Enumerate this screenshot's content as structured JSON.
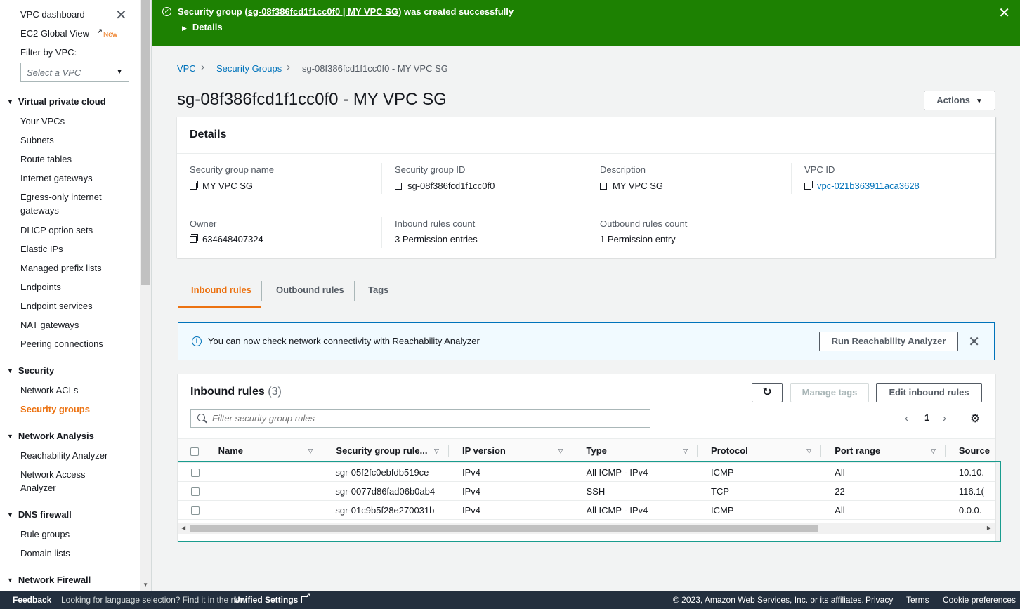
{
  "sidebar": {
    "vpc_dashboard": "VPC dashboard",
    "ec2_global_view": "EC2 Global View",
    "new_badge": "New",
    "filter_label": "Filter by VPC:",
    "vpc_select_placeholder": "Select a VPC",
    "sections": [
      {
        "title": "Virtual private cloud",
        "items": [
          "Your VPCs",
          "Subnets",
          "Route tables",
          "Internet gateways",
          "Egress-only internet gateways",
          "DHCP option sets",
          "Elastic IPs",
          "Managed prefix lists",
          "Endpoints",
          "Endpoint services",
          "NAT gateways",
          "Peering connections"
        ]
      },
      {
        "title": "Security",
        "items": [
          "Network ACLs",
          "Security groups"
        ]
      },
      {
        "title": "Network Analysis",
        "items": [
          "Reachability Analyzer",
          "Network Access Analyzer"
        ]
      },
      {
        "title": "DNS firewall",
        "items": [
          "Rule groups",
          "Domain lists"
        ]
      },
      {
        "title": "Network Firewall",
        "items": []
      }
    ]
  },
  "flash": {
    "prefix": "Security group (",
    "link": "sg-08f386fcd1f1cc0f0 | MY VPC SG",
    "suffix": ") was created successfully",
    "details": "Details",
    "color": "#1d8102"
  },
  "breadcrumb": [
    "VPC",
    "Security Groups",
    "sg-08f386fcd1f1cc0f0 - MY VPC SG"
  ],
  "page_title": "sg-08f386fcd1f1cc0f0 - MY VPC SG",
  "actions_label": "Actions",
  "details": {
    "header": "Details",
    "sg_name_label": "Security group name",
    "sg_name": "MY VPC SG",
    "sg_id_label": "Security group ID",
    "sg_id": "sg-08f386fcd1f1cc0f0",
    "description_label": "Description",
    "description": "MY VPC SG",
    "vpc_id_label": "VPC ID",
    "vpc_id": "vpc-021b363911aca3628",
    "owner_label": "Owner",
    "owner": "634648407324",
    "inbound_count_label": "Inbound rules count",
    "inbound_count": "3 Permission entries",
    "outbound_count_label": "Outbound rules count",
    "outbound_count": "1 Permission entry"
  },
  "tabs": [
    "Inbound rules",
    "Outbound rules",
    "Tags"
  ],
  "info_banner": {
    "message": "You can now check network connectivity with Reachability Analyzer",
    "button": "Run Reachability Analyzer"
  },
  "rules_panel": {
    "title": "Inbound rules",
    "count": "(3)",
    "manage_tags": "Manage tags",
    "edit_rules": "Edit inbound rules",
    "filter_placeholder": "Filter security group rules",
    "page": "1",
    "columns": [
      "Name",
      "Security group rule...",
      "IP version",
      "Type",
      "Protocol",
      "Port range",
      "Source"
    ],
    "rows": [
      [
        "–",
        "sgr-05f2fc0ebfdb519ce",
        "IPv4",
        "All ICMP - IPv4",
        "ICMP",
        "All",
        "10.10."
      ],
      [
        "–",
        "sgr-0077d86fad06b0ab4",
        "IPv4",
        "SSH",
        "TCP",
        "22",
        "116.1("
      ],
      [
        "–",
        "sgr-01c9b5f28e270031b",
        "IPv4",
        "All ICMP - IPv4",
        "ICMP",
        "All",
        "0.0.0."
      ]
    ]
  },
  "footer": {
    "feedback": "Feedback",
    "language_note": "Looking for language selection? Find it in the new",
    "unified_settings": "Unified Settings",
    "copyright": "© 2023, Amazon Web Services, Inc. or its affiliates.",
    "privacy": "Privacy",
    "terms": "Terms",
    "cookie": "Cookie preferences"
  },
  "colors": {
    "accent": "#ec7211",
    "link": "#0073bb",
    "footer_bg": "#232f3e"
  }
}
